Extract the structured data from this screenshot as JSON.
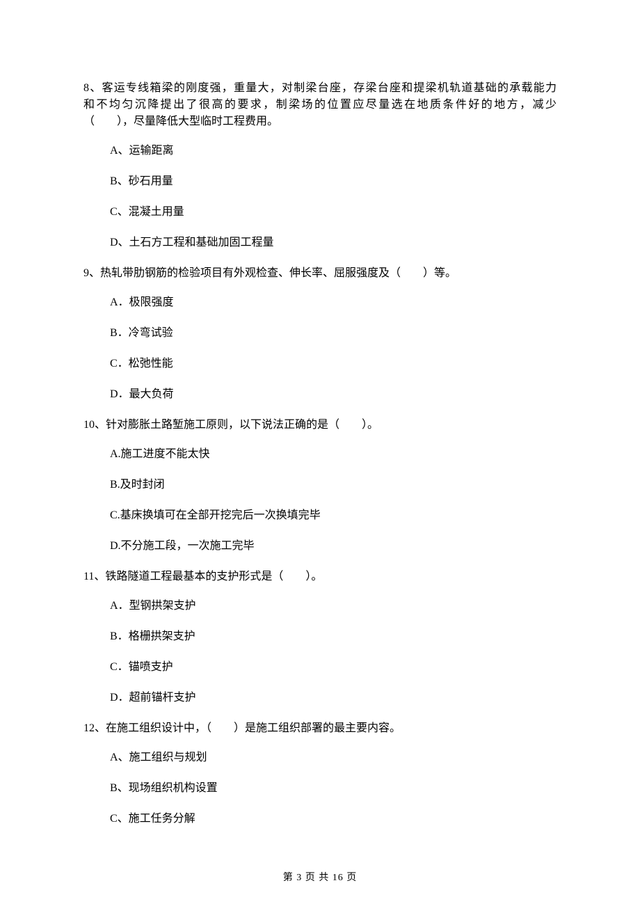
{
  "questions": [
    {
      "number": "8、",
      "stem_lines": [
        "客运专线箱梁的刚度强，重量大，对制梁台座，存梁台座和提梁机轨道基础的承载能力",
        "和不均匀沉降提出了很高的要求，制梁场的位置应尽量选在地质条件好的地方，减少",
        "（　　），尽量降低大型临时工程费用。"
      ],
      "options": [
        "A、运输距离",
        "B、砂石用量",
        "C、混凝土用量",
        "D、土石方工程和基础加固工程量"
      ]
    },
    {
      "number": "9、",
      "stem_lines": [
        "热轧带肋钢筋的检验项目有外观检查、伸长率、屈服强度及（　　）等。"
      ],
      "options": [
        "A．极限强度",
        "B．冷弯试验",
        "C．松弛性能",
        "D．最大负荷"
      ]
    },
    {
      "number": "10、",
      "stem_lines": [
        "针对膨胀土路堑施工原则，以下说法正确的是（　　）。"
      ],
      "options": [
        "A.施工进度不能太快",
        "B.及时封闭",
        "C.基床换填可在全部开挖完后一次换填完毕",
        "D.不分施工段，一次施工完毕"
      ]
    },
    {
      "number": "11、",
      "stem_lines": [
        "铁路隧道工程最基本的支护形式是（　　）。"
      ],
      "options": [
        "A．型钢拱架支护",
        "B．格栅拱架支护",
        "C．锚喷支护",
        "D．超前锚杆支护"
      ]
    },
    {
      "number": "12、",
      "stem_lines": [
        "在施工组织设计中，（　　）是施工组织部署的最主要内容。"
      ],
      "options": [
        "A、施工组织与规划",
        "B、现场组织机构设置",
        "C、施工任务分解"
      ]
    }
  ],
  "footer": "第 3 页 共 16 页"
}
